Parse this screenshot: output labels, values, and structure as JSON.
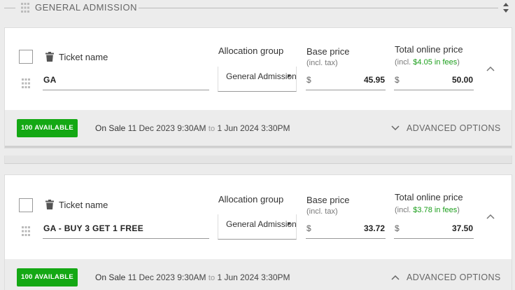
{
  "section": {
    "title": "GENERAL ADMISSION"
  },
  "tickets": [
    {
      "ticket_name_label": "Ticket name",
      "name_value": "GA",
      "allocation_label": "Allocation group",
      "allocation_value": "General Admission",
      "base_price_label": "Base price",
      "base_price_sub": "(incl. tax)",
      "base_currency": "$",
      "base_price": "45.95",
      "total_label": "Total online price",
      "total_sub_prefix": "(incl. ",
      "total_fee": "$4.05 in fees",
      "total_sub_suffix": ")",
      "total_currency": "$",
      "total_price": "50.00",
      "badge": "100 AVAILABLE",
      "on_sale_label": "On Sale",
      "sale_start": "11 Dec 2023 9:30AM",
      "sale_to": "to",
      "sale_end": "1 Jun 2024 3:30PM",
      "advanced_label": "ADVANCED OPTIONS"
    },
    {
      "ticket_name_label": "Ticket name",
      "name_value": "GA - BUY 3 GET 1 FREE",
      "allocation_label": "Allocation group",
      "allocation_value": "General Admission",
      "base_price_label": "Base price",
      "base_price_sub": "(incl. tax)",
      "base_currency": "$",
      "base_price": "33.72",
      "total_label": "Total online price",
      "total_sub_prefix": "(incl. ",
      "total_fee": "$3.78 in fees",
      "total_sub_suffix": ")",
      "total_currency": "$",
      "total_price": "37.50",
      "badge": "100 AVAILABLE",
      "on_sale_label": "On Sale",
      "sale_start": "11 Dec 2023 9:30AM",
      "sale_to": "to",
      "sale_end": "1 Jun 2024 3:30PM",
      "advanced_label": "ADVANCED OPTIONS"
    }
  ],
  "colors": {
    "badge": "#14a814",
    "fee": "#1b9e1b",
    "footer_bg": "#ececec"
  },
  "icons": [
    "grip-icon",
    "sort-icon",
    "trash-icon",
    "chevron-up-icon",
    "chevron-down-icon",
    "dropdown-caret-icon"
  ]
}
